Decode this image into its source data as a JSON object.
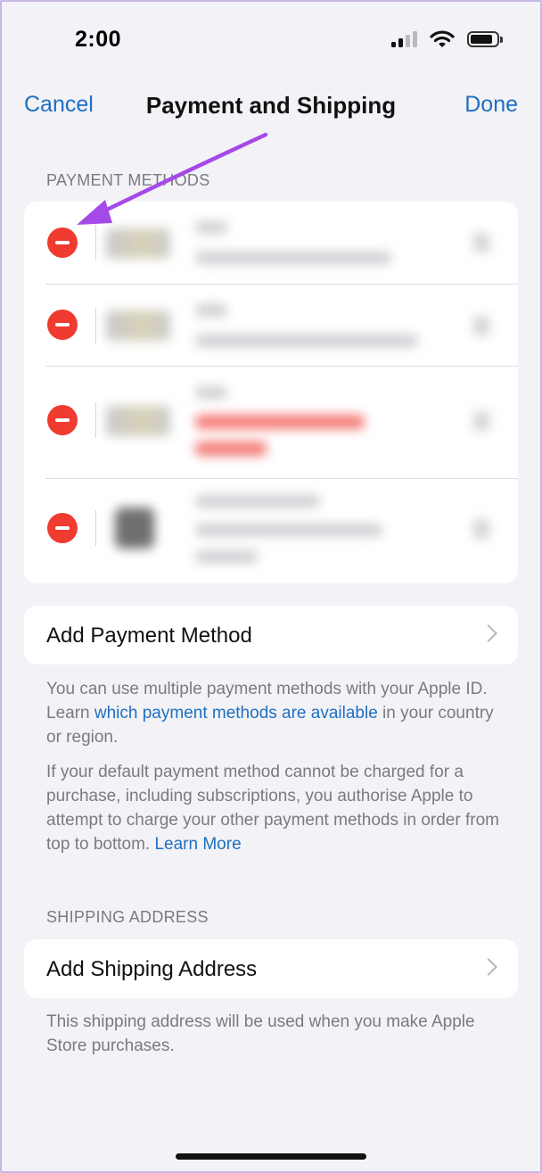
{
  "status_bar": {
    "time": "2:00",
    "signal_icon": "cellular-signal-icon",
    "wifi_icon": "wifi-icon",
    "battery_icon": "battery-icon",
    "signal_bars_on": 2,
    "signal_bars_total": 4
  },
  "nav": {
    "cancel_label": "Cancel",
    "title": "Payment and Shipping",
    "done_label": "Done"
  },
  "payment_methods": {
    "header": "PAYMENT METHODS",
    "row_count": 4,
    "delete_icon": "minus-circle-icon",
    "content_redacted": true
  },
  "add_payment": {
    "label": "Add Payment Method",
    "icon": "chevron-right-icon"
  },
  "payment_note": {
    "text_before": "You can use multiple payment methods with your Apple ID. Learn ",
    "link_text": "which payment methods are available",
    "text_after": " in your country or region."
  },
  "default_note": {
    "text": "If your default payment method cannot be charged for a purchase, including subscriptions, you authorise Apple to attempt to charge your other payment methods in order from top to bottom. ",
    "link_text": "Learn More"
  },
  "shipping": {
    "header": "SHIPPING ADDRESS",
    "add_label": "Add Shipping Address",
    "icon": "chevron-right-icon",
    "note": "This shipping address will be used when you make Apple Store purchases."
  },
  "annotation": {
    "icon": "arrow-annotation-icon",
    "color": "#a549e8"
  },
  "colors": {
    "accent": "#1f6fc0",
    "delete_red": "#ef3b30",
    "background": "#f2f2f7"
  }
}
